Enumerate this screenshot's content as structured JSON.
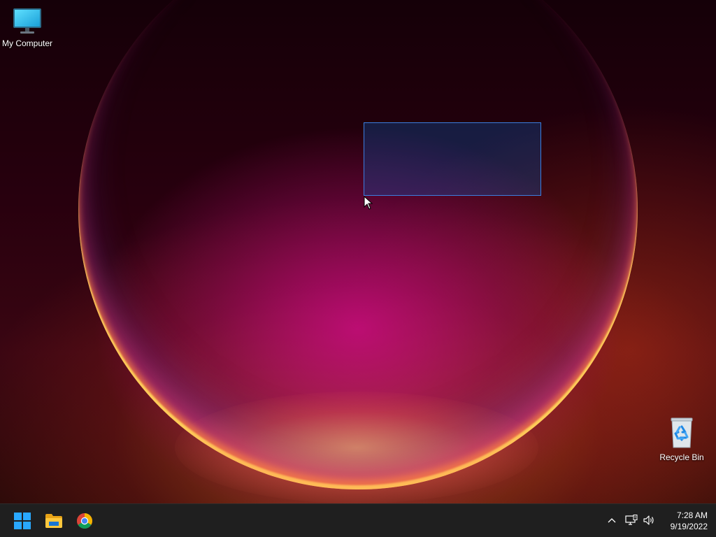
{
  "desktop": {
    "icons": [
      {
        "label": "My Computer",
        "icon": "monitor-icon"
      },
      {
        "label": "Recycle Bin",
        "icon": "recycle-bin-icon"
      }
    ]
  },
  "taskbar": {
    "pinned": [
      {
        "name": "start",
        "icon": "windows-logo-icon"
      },
      {
        "name": "file-explorer",
        "icon": "folder-icon"
      },
      {
        "name": "chrome",
        "icon": "chrome-icon"
      }
    ],
    "tray": {
      "icons": [
        "chevron-up-icon",
        "network-icon",
        "volume-icon"
      ],
      "time": "7:28 AM",
      "date": "9/19/2022"
    }
  },
  "colors": {
    "taskbar_bg": "#1f1f1f",
    "selection_fill": "#0066cc",
    "selection_border": "#3b7fe0",
    "windows_blue": "#29a8ff",
    "folder_yellow": "#ffc83d"
  }
}
